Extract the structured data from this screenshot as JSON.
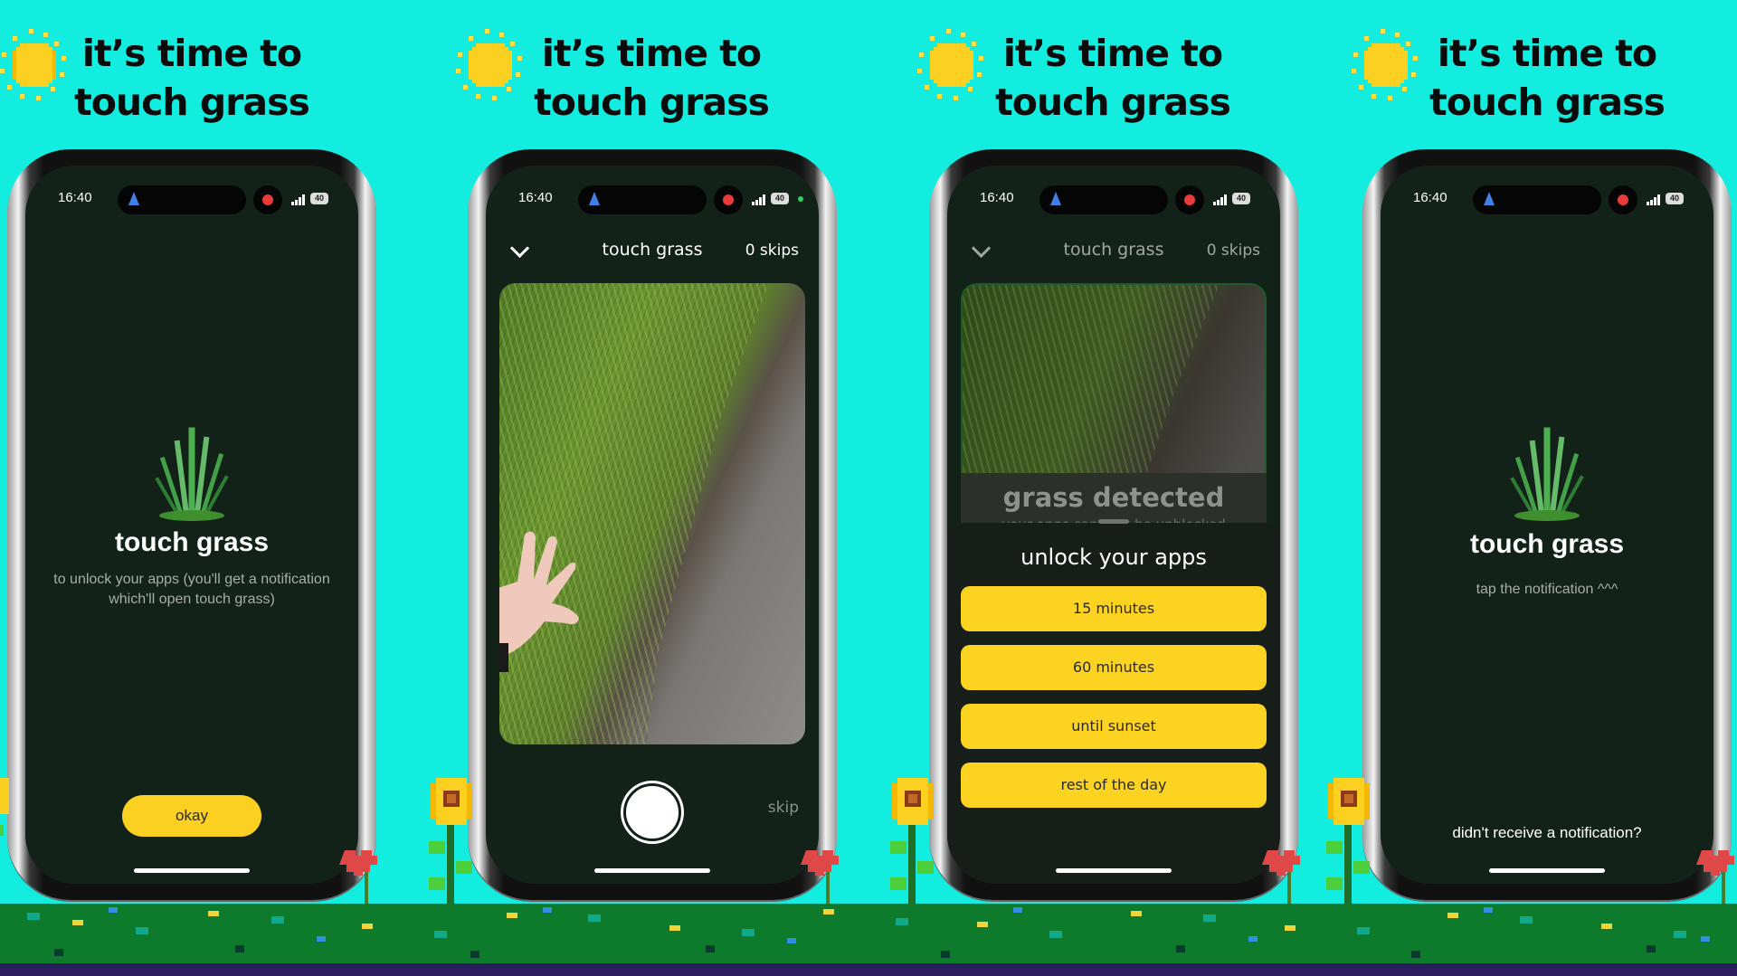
{
  "colors": {
    "background": "#12ede0",
    "screen": "#132219",
    "button_yellow": "#fcd321",
    "record_dot": "#e93b3b",
    "nav_arrow": "#3f7fe6"
  },
  "headline": {
    "line1": "it’s time to",
    "line2": "touch grass"
  },
  "status_bar": {
    "time": "16:40",
    "battery": "40",
    "icons": [
      "location-arrow-icon",
      "screen-record-icon",
      "signal-icon",
      "battery-icon"
    ]
  },
  "screens": [
    {
      "id": "intro",
      "title": "touch grass",
      "subtitle": "to unlock your apps (you'll get a notification which'll open touch grass)",
      "button": "okay",
      "icon": "grass-icon"
    },
    {
      "id": "camera",
      "nav": {
        "back_icon": "chevron-down-icon",
        "title": "touch grass",
        "skips": "0 skips"
      },
      "shutter_icon": "shutter-icon",
      "skip": "skip"
    },
    {
      "id": "unlock",
      "nav": {
        "back_icon": "chevron-down-icon",
        "title": "touch grass",
        "skips": "0 skips"
      },
      "detected_title": "grass detected",
      "detected_subtitle": "your apps can now be unblocked",
      "sheet_title": "unlock your apps",
      "options": [
        "15 minutes",
        "60 minutes",
        "until sunset",
        "rest of the day"
      ]
    },
    {
      "id": "notify",
      "title": "touch grass",
      "subtitle": "tap the notification ^^^",
      "link": "didn't receive a notification?",
      "icon": "grass-icon"
    }
  ]
}
